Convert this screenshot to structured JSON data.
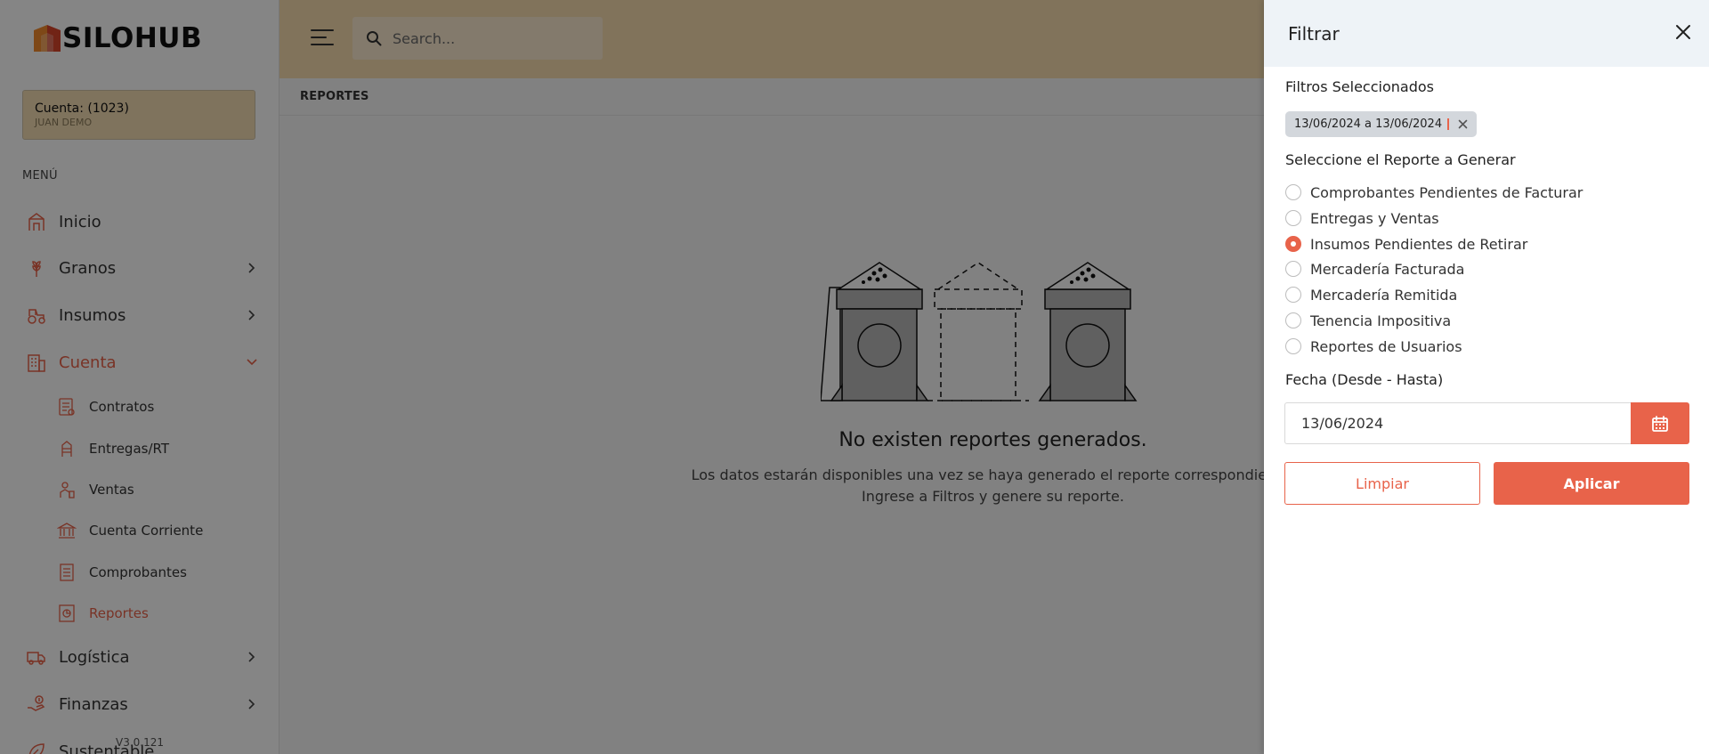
{
  "colors": {
    "accent": "#e8634a",
    "topbar": "#f7dcae",
    "account_bg": "#f4dcb3",
    "chip_bg": "#d3d7dc"
  },
  "sidebar": {
    "logo_text": "SILOHUB",
    "account": {
      "title": "Cuenta: (1023)",
      "user": "JUAN DEMO"
    },
    "menu_label": "MENÚ",
    "items": [
      {
        "label": "Inicio",
        "icon": "silo-icon"
      },
      {
        "label": "Granos",
        "icon": "wheat-icon",
        "expandable": true
      },
      {
        "label": "Insumos",
        "icon": "tractor-icon",
        "expandable": true
      },
      {
        "label": "Cuenta",
        "icon": "building-icon",
        "expandable": true,
        "active": true
      },
      {
        "label": "Logística",
        "icon": "truck-icon",
        "expandable": true
      },
      {
        "label": "Finanzas",
        "icon": "hand-money-icon",
        "expandable": true
      },
      {
        "label": "Sustentable",
        "icon": "leaf-icon"
      }
    ],
    "sub_items": [
      {
        "label": "Contratos",
        "icon": "contract-icon"
      },
      {
        "label": "Entregas/RT",
        "icon": "silo-delivery-icon"
      },
      {
        "label": "Ventas",
        "icon": "sales-icon"
      },
      {
        "label": "Cuenta Corriente",
        "icon": "bank-icon"
      },
      {
        "label": "Comprobantes",
        "icon": "receipt-icon"
      },
      {
        "label": "Reportes",
        "icon": "report-icon",
        "active": true
      }
    ],
    "version": "V3.0.121"
  },
  "topbar": {
    "search_placeholder": "Search..."
  },
  "breadcrumb": "REPORTES",
  "empty_state": {
    "title": "No existen reportes generados.",
    "line1": "Los datos estarán disponibles una vez se haya generado el reporte correspondiente.",
    "line2": "Ingrese a Filtros y genere su reporte."
  },
  "filter_panel": {
    "title": "Filtrar",
    "selected_label": "Filtros Seleccionados",
    "chip_text": "13/06/2024 a 13/06/2024",
    "report_label": "Seleccione el Reporte a Generar",
    "options": [
      {
        "label": "Comprobantes Pendientes de Facturar",
        "checked": false
      },
      {
        "label": "Entregas y Ventas",
        "checked": false
      },
      {
        "label": "Insumos Pendientes de Retirar",
        "checked": true
      },
      {
        "label": "Mercadería Facturada",
        "checked": false
      },
      {
        "label": "Mercadería Remitida",
        "checked": false
      },
      {
        "label": "Tenencia Impositiva",
        "checked": false
      },
      {
        "label": "Reportes de Usuarios",
        "checked": false
      }
    ],
    "date_label": "Fecha (Desde - Hasta)",
    "date_value": "13/06/2024",
    "clear_label": "Limpiar",
    "apply_label": "Aplicar"
  }
}
